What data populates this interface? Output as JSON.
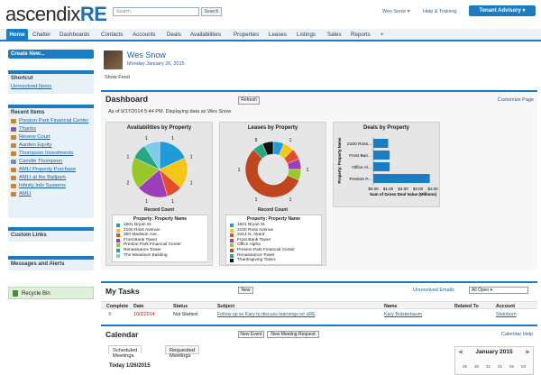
{
  "header": {
    "logo_main": "ascendix",
    "logo_accent": "RE",
    "search_placeholder": "Search...",
    "search_button": "Search",
    "user_menu": "Wes Snow ▾",
    "help": "Help & Training",
    "app_menu": "Tenant Advisory ▾"
  },
  "nav": [
    "Home",
    "Chatter",
    "Dashboards",
    "Contacts",
    "Accounts",
    "Deals",
    "Availabilities",
    "Properties",
    "Leases",
    "Listings",
    "Sales",
    "Reports",
    "+"
  ],
  "sidebar": {
    "create_new": "Create New...",
    "shortcut_title": "Shortcut",
    "shortcut_items": [
      "Unresolved Items"
    ],
    "recent_title": "Recent Items",
    "recent_items": [
      "Preston Park Financial Center",
      "Thanks",
      "Revere Court",
      "Aarden Equity",
      "Thompson Investments",
      "Camille Thompson",
      "AMLI Property Purchase",
      "AMLI at the Ballpark",
      "Infinity Info Systems",
      "AMLI"
    ],
    "custom_links": "Custom Links",
    "messages": "Messages and Alerts",
    "recycle": "Recycle Bin"
  },
  "feed": {
    "name": "Wes Snow",
    "date": "Monday January 26, 2015",
    "show_feed": "Show Feed"
  },
  "dashboard": {
    "title": "Dashboard",
    "refresh": "Refresh",
    "customize": "Customize Page",
    "as_of": "As of 9/17/2014 5:44 PM. Displaying data as Wes Snow."
  },
  "charts": [
    {
      "title": "Availabilities by Property",
      "measure": "Record Count",
      "legend_title": "Property: Property Name",
      "legend": [
        "1601 Bryan St.",
        "2100 Ross Avenue",
        "300 Madison Ave.",
        "Frost Bank Tower",
        "Preston Park Financial Center",
        "Renaissance Tower",
        "The Meadows Building"
      ],
      "slice_labels": [
        "1",
        "1",
        "1",
        "1",
        "1",
        "2",
        "1",
        "1"
      ]
    },
    {
      "title": "Leases by Property",
      "measure": "Record Count",
      "legend_title": "Property: Property Name",
      "legend": [
        "1601 Bryan St.",
        "2100 Ross Avenue",
        "2414 N. Akard",
        "Frost Bank Tower",
        "Office Alpha",
        "Preston Park Financial Center",
        "Renaissance Tower",
        "Thanksgiving Tower"
      ],
      "slice_labels": [
        "1",
        "1",
        "1",
        "1",
        "1",
        "9"
      ]
    },
    {
      "title": "Deals by Property",
      "ylabel": "Property: Property Name",
      "xlabel": "Sum of Gross Deal Value (Millions)",
      "categories": [
        "2100 Ross...",
        "Frost Ban...",
        "Office Al...",
        "Preston P..."
      ],
      "ticks": [
        "$0.00",
        "$1.00",
        "$2.00",
        "$3.00",
        "$4.00"
      ]
    }
  ],
  "chart_data": [
    {
      "type": "pie",
      "title": "Availabilities by Property",
      "categories": [
        "1601 Bryan St.",
        "2100 Ross Avenue",
        "300 Madison Ave.",
        "Frost Bank Tower",
        "Preston Park Financial Center",
        "Renaissance Tower",
        "The Meadows Building"
      ],
      "values": [
        2,
        2,
        1,
        2,
        2,
        1,
        1
      ]
    },
    {
      "type": "pie",
      "title": "Leases by Property",
      "categories": [
        "1601 Bryan St.",
        "2100 Ross Avenue",
        "2414 N. Akard",
        "Frost Bank Tower",
        "Office Alpha",
        "Preston Park Financial Center",
        "Renaissance Tower",
        "Thanksgiving Tower"
      ],
      "values": [
        1,
        1,
        1,
        1,
        1,
        9,
        1,
        1
      ]
    },
    {
      "type": "bar",
      "title": "Deals by Property",
      "categories": [
        "2100 Ross...",
        "Frost Ban...",
        "Office Al...",
        "Preston P..."
      ],
      "values": [
        1.0,
        1.1,
        1.1,
        3.8
      ],
      "xlim": [
        0,
        4
      ]
    }
  ],
  "colors": {
    "accent": "#1a7dc4",
    "pie1": [
      "#1f9bd8",
      "#f5c518",
      "#e34d2b",
      "#9c3fb6",
      "#98c72c",
      "#27a884",
      "#7fcbe7",
      "#e58a2e"
    ],
    "pie2": [
      "#1f9bd8",
      "#f5c518",
      "#e34d2b",
      "#9c3fb6",
      "#98c72c",
      "#c0461f",
      "#27a884",
      "#111111"
    ],
    "bar": "#1a7dc4"
  },
  "tasks": {
    "title": "My Tasks",
    "new": "New",
    "unresolved": "Unresolved Emails",
    "filter": "All Open",
    "columns": [
      "Complete",
      "Date",
      "Status",
      "Subject",
      "Name",
      "Related To",
      "Account"
    ],
    "rows": [
      {
        "complete": "X",
        "date": "10/2/2014",
        "status": "Not Started",
        "subject": "Follow up w/ Kary to discuss learnings on xRE",
        "name": "Kary Bulsterbaum",
        "related": "",
        "account": "Steinborn"
      }
    ]
  },
  "calendar": {
    "title": "Calendar",
    "new_event": "New Event",
    "new_meeting": "New Meeting Request",
    "help": "Calendar Help",
    "tabs": [
      "Scheduled Meetings",
      "Requested Meetings"
    ],
    "today": "Today 1/26/2015",
    "month": "January 2015",
    "days": [
      "29",
      "30",
      "31",
      "01",
      "02",
      "03"
    ]
  }
}
